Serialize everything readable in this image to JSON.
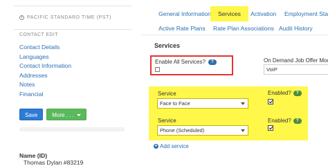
{
  "sidebar": {
    "timezone": "PACIFIC STANDARD TIME (PST)",
    "section_label": "CONTACT EDIT",
    "nav_items": [
      {
        "label": "Contact Details"
      },
      {
        "label": "Languages"
      },
      {
        "label": "Contact Information"
      },
      {
        "label": "Addresses"
      },
      {
        "label": "Notes"
      },
      {
        "label": "Financial"
      }
    ],
    "save_label": "Save",
    "more_label": "More . . .",
    "name_label": "Name (ID)",
    "name_value": "Thomas Dylan #83219"
  },
  "tabs": {
    "row1": [
      {
        "label": "General Information"
      },
      {
        "label": "Services"
      },
      {
        "label": "Activation"
      },
      {
        "label": "Employment Status"
      }
    ],
    "row2": [
      {
        "label": "Active Rate Plans"
      },
      {
        "label": "Rate Plan Associations"
      },
      {
        "label": "Audit History"
      }
    ],
    "active": "Services"
  },
  "content": {
    "section_title": "Services",
    "enable_all": {
      "label": "Enable All Services?",
      "help": "?",
      "checked": false
    },
    "on_demand": {
      "label": "On Demand Job Offer Mode",
      "value": "VoIP"
    },
    "services": [
      {
        "service_label": "Service",
        "value": "Face to Face",
        "enabled_label": "Enabled?",
        "help": "?",
        "enabled": true
      },
      {
        "service_label": "Service",
        "value": "Phone (Scheduled)",
        "enabled_label": "Enabled?",
        "help": "?",
        "enabled": true
      }
    ],
    "add_service": "Add service"
  },
  "colors": {
    "highlight": "#fff74a",
    "link": "#2a6fb3",
    "alert_border": "#e3342f",
    "save": "#2e7bd5",
    "more": "#5cb85c"
  }
}
